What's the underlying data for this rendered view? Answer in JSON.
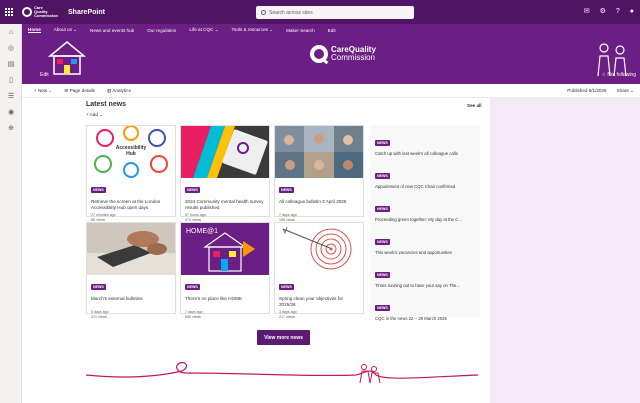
{
  "suitebar": {
    "org_logo_text": "Care Quality Commission",
    "app_name": "SharePoint",
    "search_placeholder": "Search across sites",
    "icons": [
      "chat-icon",
      "settings-icon",
      "help-icon",
      "account-icon"
    ]
  },
  "nav": {
    "items": [
      "Home",
      "About us ⌄",
      "News and events hub",
      "Our regulation",
      "Life at CQC ⌄",
      "Tools & resources ⌄",
      "Maker Search",
      "Edit"
    ]
  },
  "leftrail": {
    "icons": [
      "home-icon",
      "globe-icon",
      "news-icon",
      "files-icon",
      "lists-icon",
      "people-icon",
      "add-icon"
    ]
  },
  "banner": {
    "edit_label": "Edit",
    "brand_line1": "CareQuality",
    "brand_line2": "Commission",
    "follow_label": "☆ Not following"
  },
  "command_bar": {
    "new_label": "+ New ⌄",
    "page_details_label": "Page details",
    "analytics_label": "Analytics",
    "published_label": "Published 8/1/2025",
    "share_label": "Share ⌄"
  },
  "news": {
    "title": "Latest news",
    "see_all": "See all",
    "add_label": "+ Add ⌄",
    "cards": [
      {
        "badge": "NEWS",
        "title": "Retrieve the screen at the London Accessibility Hub open days",
        "meta1": "27 minutes ago",
        "meta2": "86 views"
      },
      {
        "badge": "NEWS",
        "title": "2024 Community mental health survey results published",
        "meta1": "57 hours ago",
        "meta2": "374 views"
      },
      {
        "badge": "NEWS",
        "title": "All colleague bulletin 3 April 2025",
        "meta1": "7 days ago",
        "meta2": "185 views"
      },
      {
        "badge": "NEWS",
        "title": "March's external bulletins",
        "meta1": "5 days ago",
        "meta2": "221 views"
      },
      {
        "badge": "NEWS",
        "title": "There's no place like HOME",
        "meta1": "7 days ago",
        "meta2": "685 views"
      },
      {
        "badge": "NEWS",
        "title": "Spring clean your objectives for 2025/26",
        "meta1": "3 days ago",
        "meta2": "217 views"
      }
    ],
    "list": [
      {
        "badge": "NEWS",
        "title": "Catch up with last week's all colleague calls"
      },
      {
        "badge": "NEWS",
        "title": "Appointment of new CQC Chair confirmed"
      },
      {
        "badge": "NEWS",
        "title": "Proceeding green together: My day at the C..."
      },
      {
        "badge": "NEWS",
        "title": "This week's vacancies and opportunities"
      },
      {
        "badge": "NEWS",
        "title": "Times running out to have your say on The..."
      },
      {
        "badge": "NEWS",
        "title": "CQC in the news 22 – 28 March 2025"
      }
    ],
    "view_more": "View more news"
  },
  "image_text": {
    "accessibility_hub_line1": "Accessibility",
    "accessibility_hub_line2": "Hub",
    "home_text": "HOME@1"
  },
  "colors": {
    "suitebar": "#4f1564",
    "brand_purple": "#6b1e83",
    "panel_pink": "#f5e8f7",
    "deco_line": "#c2185b"
  }
}
